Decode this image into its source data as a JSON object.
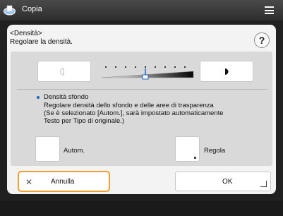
{
  "app": {
    "title": "Copia",
    "icon": "copy-app-icon"
  },
  "dialog": {
    "header_line1": "<Densità>",
    "header_line2": "Regolare la densità.",
    "help_label": "?"
  },
  "density": {
    "level": 5,
    "levels_total": 9
  },
  "background_density": {
    "title": "Densità sfondo",
    "lines": [
      "Regolare densità dello sfondo e delle aree di trasparenza",
      "(Se è selezionato [Autom.], sarà impostato automaticamente",
      "Testo per Tipo di originale.)"
    ],
    "auto_label": "Autom.",
    "adjust_label": "Regola"
  },
  "footer": {
    "cancel_label": "Annulla",
    "ok_label": "OK"
  },
  "colors": {
    "accent_focus": "#f0a030",
    "bullet": "#1a66c2"
  }
}
